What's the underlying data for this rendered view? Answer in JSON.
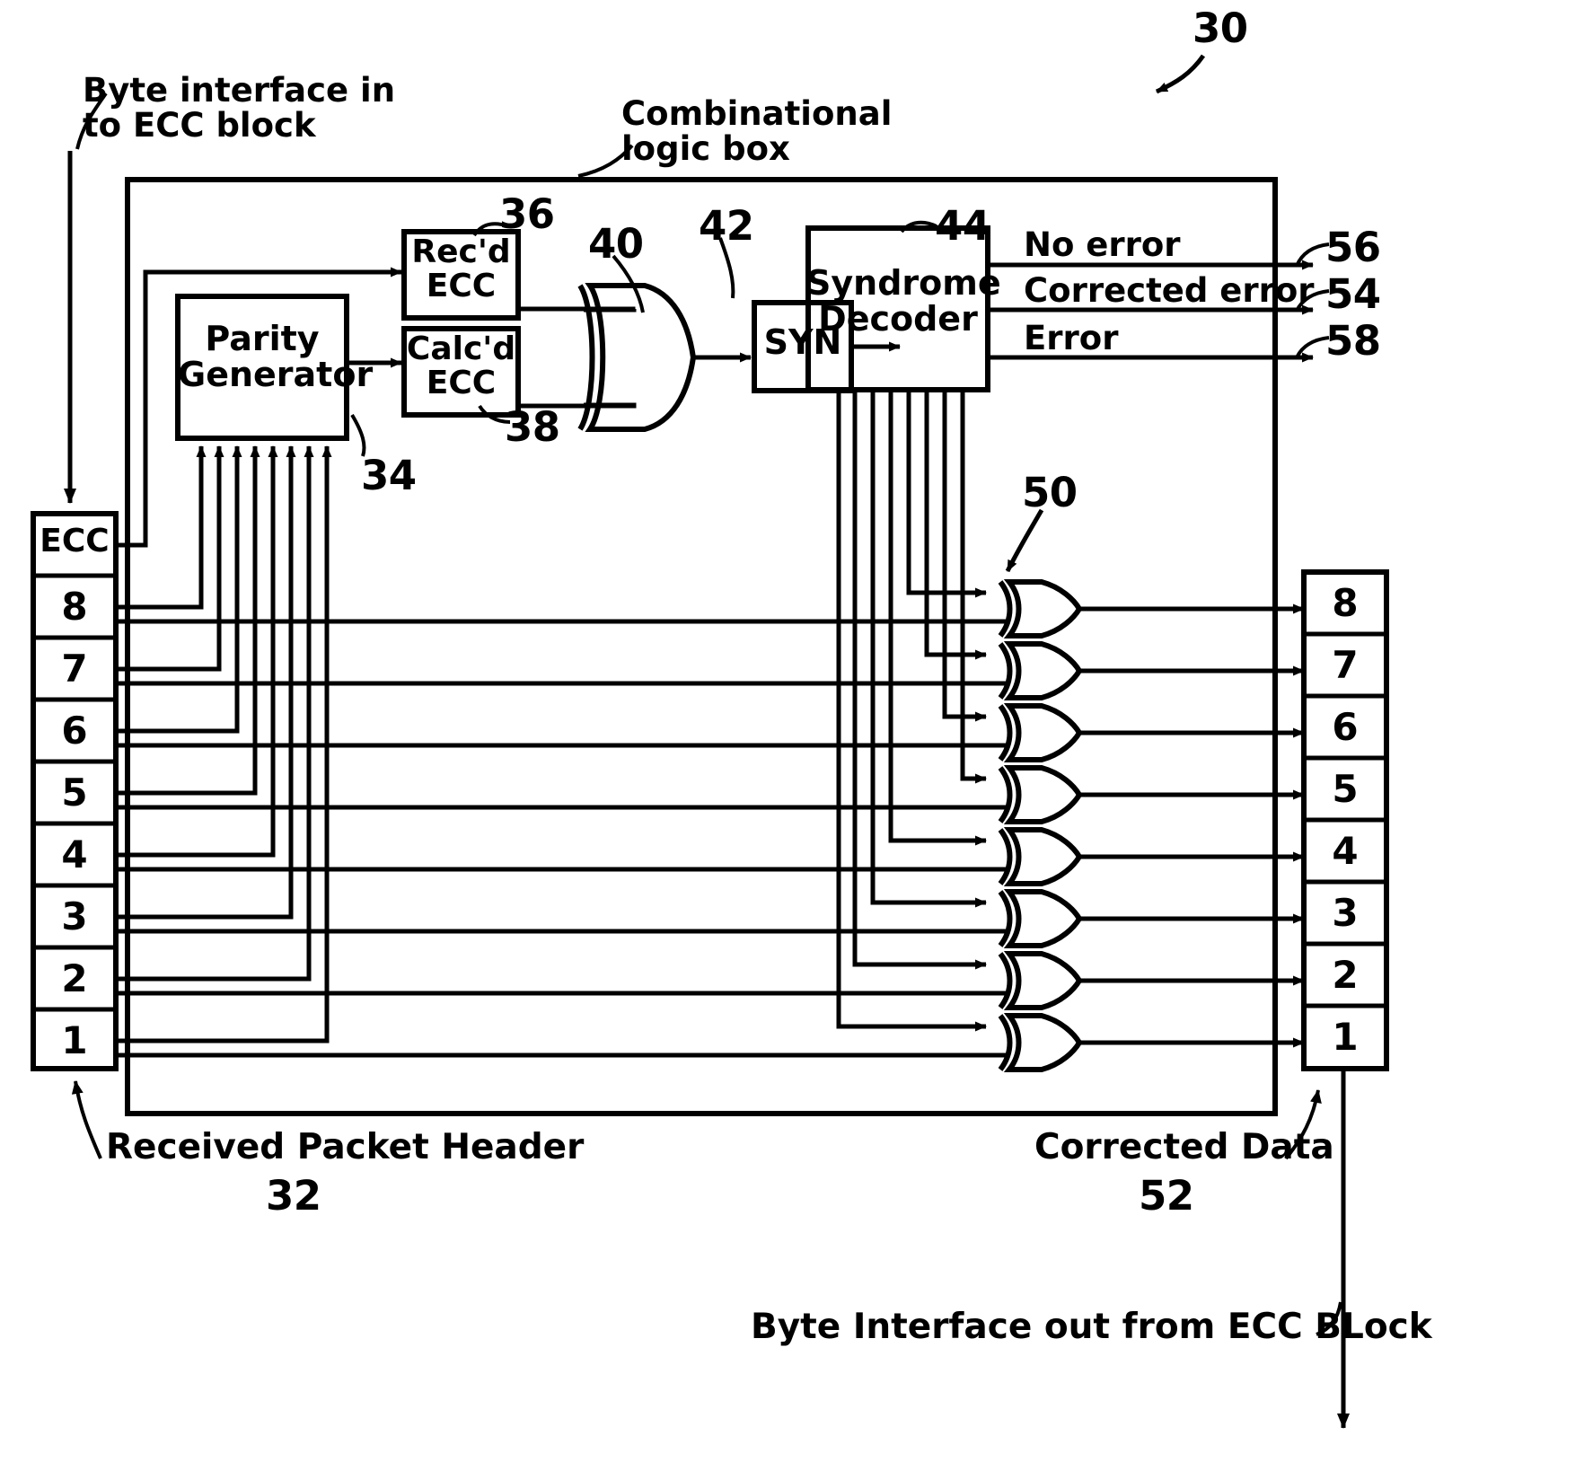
{
  "figure": {
    "ref_main": "30",
    "input_annotation": "Byte interface in\nto ECC block",
    "combinational_annotation": "Combinational\nlogic box"
  },
  "blocks": {
    "parity_generator": {
      "label": "Parity\nGenerator",
      "ref": "34"
    },
    "recd_ecc": {
      "label": "Rec'd\nECC",
      "ref": "36"
    },
    "calcd_ecc": {
      "label": "Calc'd\nECC",
      "ref": "38"
    },
    "xor_gate": {
      "ref": "40"
    },
    "syn": {
      "label": "SYN",
      "ref": "42"
    },
    "syndrome_decoder": {
      "label": "Syndrome\nDecoder",
      "ref": "44"
    },
    "correction_xors": {
      "ref": "50"
    }
  },
  "status_outputs": [
    {
      "label": "No error",
      "ref": "56"
    },
    {
      "label": "Corrected error",
      "ref": "54"
    },
    {
      "label": "Error",
      "ref": "58"
    }
  ],
  "input_register": {
    "caption": "Received Packet Header",
    "ref": "32",
    "cells": [
      "ECC",
      "8",
      "7",
      "6",
      "5",
      "4",
      "3",
      "2",
      "1"
    ]
  },
  "output_register": {
    "caption": "Corrected Data",
    "ref": "52",
    "cells": [
      "8",
      "7",
      "6",
      "5",
      "4",
      "3",
      "2",
      "1"
    ],
    "out_annotation": "Byte Interface out from ECC BLock"
  },
  "colors": {
    "ink": "#000000",
    "paper": "#ffffff"
  }
}
